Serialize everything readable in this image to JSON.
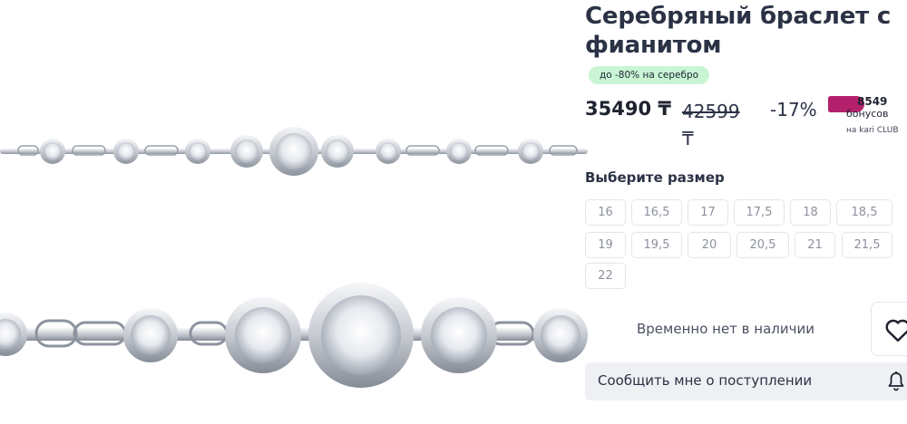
{
  "product": {
    "title": "Серебряный браслет с фианитом",
    "promo_badge": "до -80% на серебро",
    "price": "35490 ₸",
    "old_price": "42599",
    "old_price_currency": "₸",
    "discount": "-17%",
    "bonus": {
      "amount": "8549",
      "label": "бонусов",
      "club": "на kari CLUB",
      "badge_color": "#b5206d"
    }
  },
  "sizes": {
    "heading": "Выберите размер",
    "options": [
      "16",
      "16,5",
      "17",
      "17,5",
      "18",
      "18,5",
      "19",
      "19,5",
      "20",
      "20,5",
      "21",
      "21,5",
      "22"
    ]
  },
  "availability": {
    "status": "Временно нет в наличии"
  },
  "actions": {
    "notify_label": "Сообщить мне о поступлении",
    "wishlist_icon": "heart-icon",
    "notify_icon": "bell-icon"
  },
  "gallery": {
    "images": [
      "bracelet-overview-photo",
      "bracelet-closeup-photo"
    ]
  },
  "colors": {
    "promo_bg": "#c9f5d4",
    "button_bg": "#eef0f4",
    "text": "#2b3245"
  }
}
